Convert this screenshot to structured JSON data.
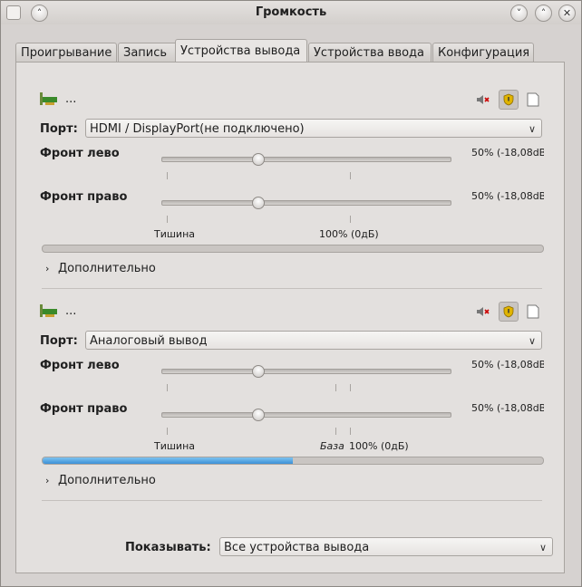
{
  "window": {
    "title": "Громкость"
  },
  "tabs": [
    {
      "label": "Проигрывание"
    },
    {
      "label": "Запись"
    },
    {
      "label": "Устройства вывода"
    },
    {
      "label": "Устройства ввода"
    },
    {
      "label": "Конфигурация"
    }
  ],
  "active_tab": "Устройства вывода",
  "devices": [
    {
      "name": "...",
      "port_label": "Порт:",
      "port_value": "HDMI / DisplayPort(не подключено)",
      "channels": [
        {
          "label": "Фронт лево",
          "value": "50% (-18,08dB",
          "level": 0.5
        },
        {
          "label": "Фронт право",
          "value": "50% (-18,08dB",
          "level": 0.5
        }
      ],
      "tick_labels": {
        "silence": "Тишина",
        "base": "",
        "full": "100% (0дБ)"
      },
      "meter_level": 0,
      "expander": "Дополнительно"
    },
    {
      "name": "...",
      "port_label": "Порт:",
      "port_value": "Аналоговый вывод",
      "channels": [
        {
          "label": "Фронт лево",
          "value": "50% (-18,08dB",
          "level": 0.5
        },
        {
          "label": "Фронт право",
          "value": "50% (-18,08dB",
          "level": 0.5
        }
      ],
      "tick_labels": {
        "silence": "Тишина",
        "base": "База",
        "full": "100% (0дБ)"
      },
      "meter_level": 0.5,
      "expander": "Дополнительно"
    }
  ],
  "show": {
    "label": "Показывать:",
    "value": "Все устройства вывода"
  },
  "colors": {
    "meter_fill": "#3b90d6",
    "background": "#d6d2d0"
  }
}
